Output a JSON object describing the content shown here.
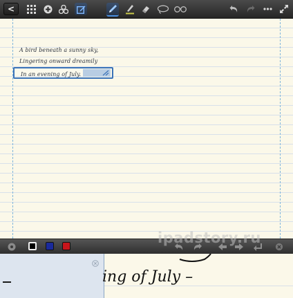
{
  "toolbar": {
    "back_label": "<",
    "active_tool": "pen",
    "icons": [
      "back-icon",
      "grid-icon",
      "add-icon",
      "share-icon",
      "edit-icon",
      "pen-icon",
      "highlighter-icon",
      "eraser-icon",
      "lasso-icon",
      "magnifier-glasses-icon",
      "undo-icon",
      "redo-icon",
      "more-icon",
      "fullscreen-icon"
    ]
  },
  "note": {
    "lines": [
      "A bird beneath a sunny sky,",
      "Lingering onward dreamily",
      "In an evening of July."
    ]
  },
  "zoom_panel": {
    "colors": [
      "#000000",
      "#1a2a9c",
      "#c8151b"
    ],
    "selected_color": "#000000",
    "watermark": "ipadstory.ru"
  },
  "zoom_area": {
    "text": "ing of July –"
  }
}
